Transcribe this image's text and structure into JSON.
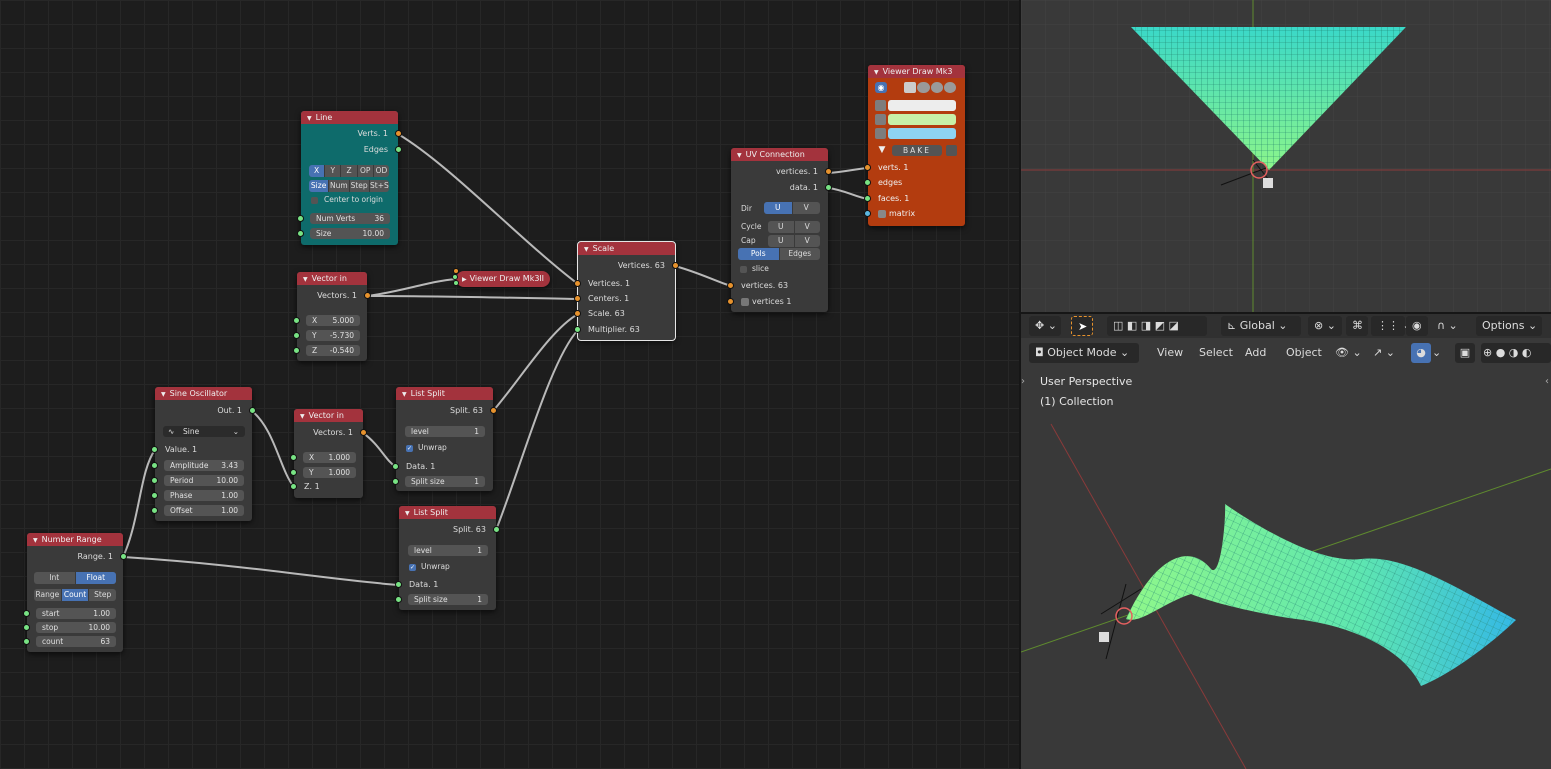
{
  "nodes": {
    "line": {
      "title": "Line",
      "out_verts": "Verts. 1",
      "out_edges": "Edges",
      "axes": [
        "X",
        "Y",
        "Z",
        "OP",
        "OD"
      ],
      "modes": [
        "Size",
        "Num",
        "Step",
        "St+S"
      ],
      "center_label": "Center to origin",
      "num_verts_label": "Num Verts",
      "num_verts_value": "36",
      "size_label": "Size",
      "size_value": "10.00",
      "color": "#0e6b6b"
    },
    "vector_in_1": {
      "title": "Vector in",
      "out": "Vectors. 1",
      "x_label": "X",
      "x_value": "5.000",
      "y_label": "Y",
      "y_value": "-5.730",
      "z_label": "Z",
      "z_value": "-0.540"
    },
    "viewer_collapsed": {
      "title": "Viewer Draw Mk3",
      "pause": "II"
    },
    "scale": {
      "title": "Scale",
      "out": "Vertices. 63",
      "in_vertices": "Vertices. 1",
      "in_centers": "Centers. 1",
      "in_scale": "Scale. 63",
      "in_multiplier": "Multiplier. 63"
    },
    "uv_connection": {
      "title": "UV Connection",
      "out_vertices": "vertices. 1",
      "out_data": "data. 1",
      "dir_label": "Dir",
      "cycle_label": "Cycle",
      "cap_label": "Cap",
      "u": "U",
      "v": "V",
      "pols": "Pols",
      "edges": "Edges",
      "slice_label": "slice",
      "in_vertices": "vertices. 63",
      "in_vertices_1": "vertices 1"
    },
    "viewer_draw": {
      "title": "Viewer Draw Mk3",
      "bake": "BAKE",
      "in_verts": "verts. 1",
      "in_edges": "edges",
      "in_faces": "faces. 1",
      "in_matrix": "matrix",
      "color_vertex": "#ededed",
      "color_edge": "#c8f0a8",
      "color_face": "#8ed3f2"
    },
    "sine": {
      "title": "Sine Oscillator",
      "out": "Out. 1",
      "mode": "Sine",
      "value_label": "Value. 1",
      "amplitude_label": "Amplitude",
      "amplitude_value": "3.43",
      "period_label": "Period",
      "period_value": "10.00",
      "phase_label": "Phase",
      "phase_value": "1.00",
      "offset_label": "Offset",
      "offset_value": "1.00"
    },
    "vector_in_2": {
      "title": "Vector in",
      "out": "Vectors. 1",
      "x_label": "X",
      "x_value": "1.000",
      "y_label": "Y",
      "y_value": "1.000",
      "z_label": "Z. 1"
    },
    "list_split_1": {
      "title": "List Split",
      "out": "Split. 63",
      "level_label": "level",
      "level_value": "1",
      "unwrap_label": "Unwrap",
      "data_label": "Data. 1",
      "split_size_label": "Split size",
      "split_size_value": "1"
    },
    "list_split_2": {
      "title": "List Split",
      "out": "Split. 63",
      "level_label": "level",
      "level_value": "1",
      "unwrap_label": "Unwrap",
      "data_label": "Data. 1",
      "split_size_label": "Split size",
      "split_size_value": "1"
    },
    "number_range": {
      "title": "Number Range",
      "out": "Range. 1",
      "types": [
        "Int",
        "Float"
      ],
      "modes": [
        "Range",
        "Count",
        "Step"
      ],
      "start_label": "start",
      "start_value": "1.00",
      "stop_label": "stop",
      "stop_value": "10.00",
      "count_label": "count",
      "count_value": "63"
    }
  },
  "viewport_header": {
    "orientation": "Global",
    "options": "Options",
    "mode": "Object Mode",
    "menus": [
      "View",
      "Select",
      "Add",
      "Object"
    ]
  },
  "viewport": {
    "perspective": "User Perspective",
    "collection": "(1) Collection"
  }
}
